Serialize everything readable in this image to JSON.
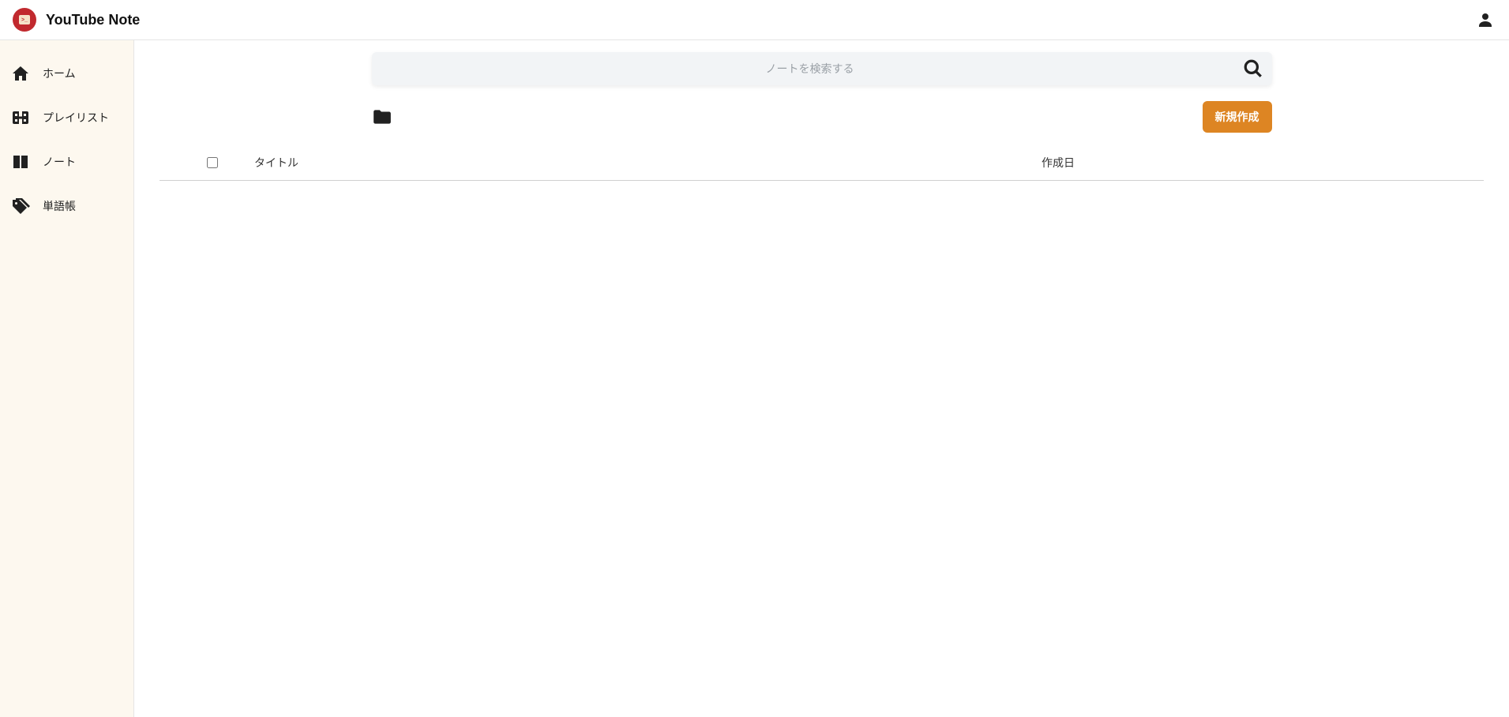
{
  "header": {
    "app_title": "YouTube Note"
  },
  "sidebar": {
    "items": [
      {
        "label": "ホーム",
        "icon": "home"
      },
      {
        "label": "プレイリスト",
        "icon": "playlist"
      },
      {
        "label": "ノート",
        "icon": "note"
      },
      {
        "label": "単語帳",
        "icon": "tags"
      }
    ]
  },
  "search": {
    "placeholder": "ノートを検索する"
  },
  "toolbar": {
    "create_label": "新規作成"
  },
  "table": {
    "headers": {
      "title": "タイトル",
      "date": "作成日"
    }
  }
}
